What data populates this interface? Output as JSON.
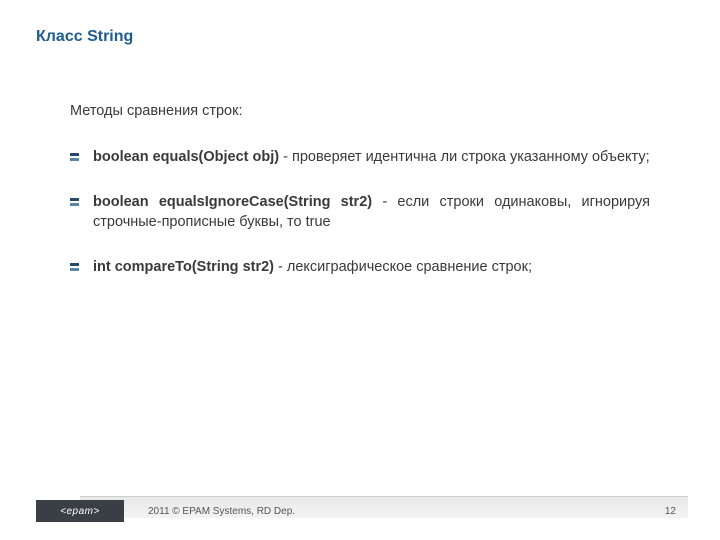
{
  "title": "Класс String",
  "intro": "Методы сравнения строк:",
  "items": [
    {
      "sig": "boolean equals(Object obj)",
      "desc": " - проверяет идентична ли строка указанному объекту;"
    },
    {
      "sig": "boolean equalsIgnoreCase(String str2)",
      "desc": " - если строки одинаковы, игнорируя строчные-прописные буквы, то true"
    },
    {
      "sig": "int compareTo(String str2)",
      "desc": " - лексиграфическое сравнение строк;"
    }
  ],
  "footer": {
    "logo": "<epam>",
    "copyright": "2011 © EPAM Systems, RD Dep.",
    "page": "12"
  }
}
